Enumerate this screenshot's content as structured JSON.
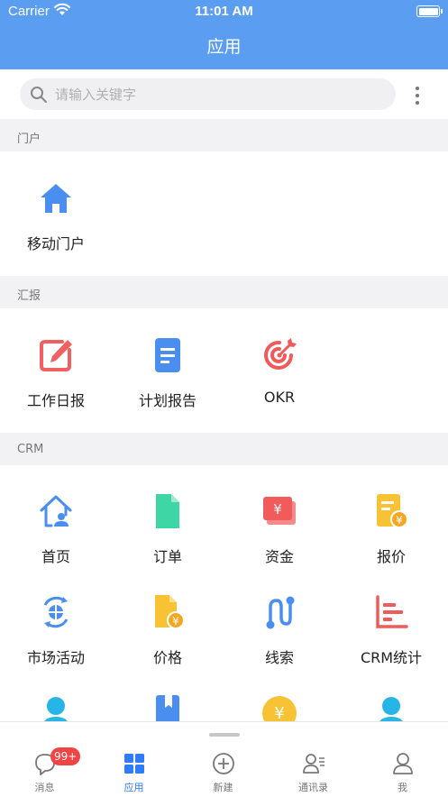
{
  "status": {
    "carrier": "Carrier",
    "time": "11:01 AM"
  },
  "header": {
    "title": "应用"
  },
  "search": {
    "placeholder": "请输入关键字"
  },
  "sections": {
    "portal": {
      "label": "门户",
      "items": [
        {
          "label": "移动门户",
          "icon": "home-icon"
        }
      ]
    },
    "report": {
      "label": "汇报",
      "items": [
        {
          "label": "工作日报",
          "icon": "edit-icon"
        },
        {
          "label": "计划报告",
          "icon": "document-icon"
        },
        {
          "label": "OKR",
          "icon": "target-icon"
        }
      ]
    },
    "crm": {
      "label": "CRM",
      "items": [
        {
          "label": "首页",
          "icon": "crm-home-icon"
        },
        {
          "label": "订单",
          "icon": "order-icon"
        },
        {
          "label": "资金",
          "icon": "funds-icon"
        },
        {
          "label": "报价",
          "icon": "quote-icon"
        },
        {
          "label": "市场活动",
          "icon": "market-activity-icon"
        },
        {
          "label": "价格",
          "icon": "price-icon"
        },
        {
          "label": "线索",
          "icon": "leads-icon"
        },
        {
          "label": "CRM统计",
          "icon": "statistics-icon"
        }
      ]
    }
  },
  "tabbar": {
    "messages": {
      "label": "消息",
      "badge": "99+"
    },
    "apps": {
      "label": "应用"
    },
    "new": {
      "label": "新建"
    },
    "contacts": {
      "label": "通讯录"
    },
    "me": {
      "label": "我"
    }
  },
  "colors": {
    "header": "#5b9df0",
    "tab_active": "#2f7df6",
    "badge": "#f14444"
  }
}
